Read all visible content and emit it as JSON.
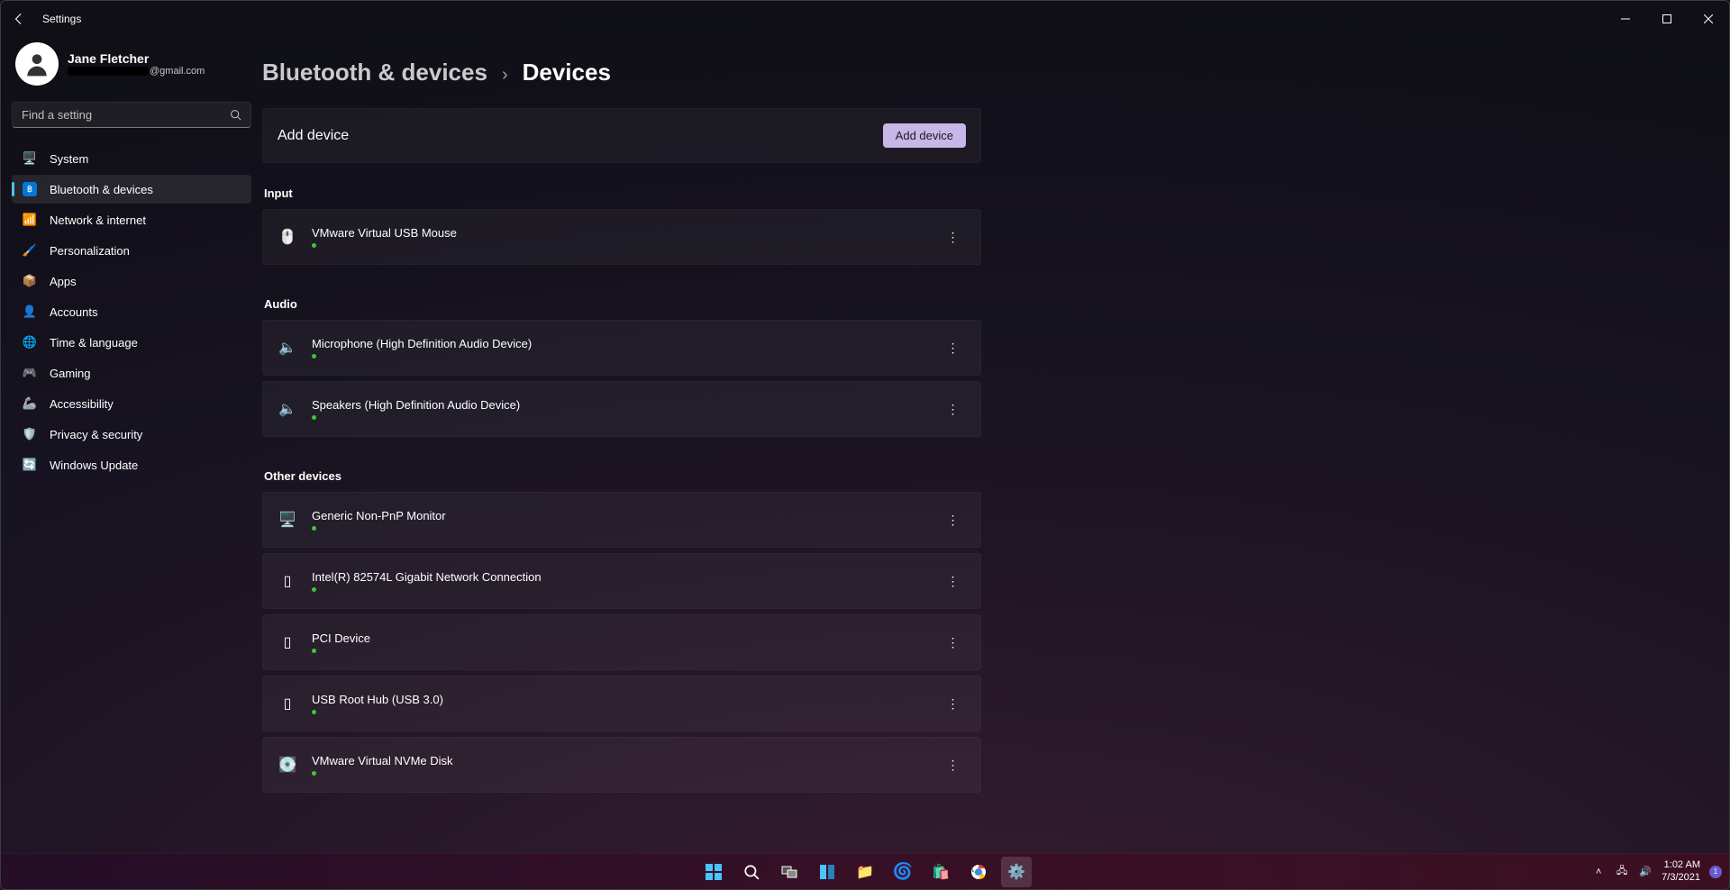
{
  "window": {
    "title": "Settings"
  },
  "profile": {
    "name": "Jane Fletcher",
    "email_suffix": "@gmail.com"
  },
  "search": {
    "placeholder": "Find a setting"
  },
  "nav": {
    "system": "System",
    "bluetooth": "Bluetooth & devices",
    "network": "Network & internet",
    "personalization": "Personalization",
    "apps": "Apps",
    "accounts": "Accounts",
    "time": "Time & language",
    "gaming": "Gaming",
    "accessibility": "Accessibility",
    "privacy": "Privacy & security",
    "update": "Windows Update"
  },
  "breadcrumb": {
    "parent": "Bluetooth & devices",
    "current": "Devices"
  },
  "add_device": {
    "label": "Add device",
    "button": "Add device"
  },
  "sections": {
    "input": {
      "title": "Input",
      "items": [
        {
          "name": "VMware Virtual USB Mouse"
        }
      ]
    },
    "audio": {
      "title": "Audio",
      "items": [
        {
          "name": "Microphone (High Definition Audio Device)"
        },
        {
          "name": "Speakers (High Definition Audio Device)"
        }
      ]
    },
    "other": {
      "title": "Other devices",
      "items": [
        {
          "name": "Generic Non-PnP Monitor"
        },
        {
          "name": "Intel(R) 82574L Gigabit Network Connection"
        },
        {
          "name": "PCI Device"
        },
        {
          "name": "USB Root Hub (USB 3.0)"
        },
        {
          "name": "VMware Virtual NVMe Disk"
        }
      ]
    }
  },
  "tray": {
    "time": "1:02 AM",
    "date": "7/3/2021",
    "badge": "1"
  }
}
